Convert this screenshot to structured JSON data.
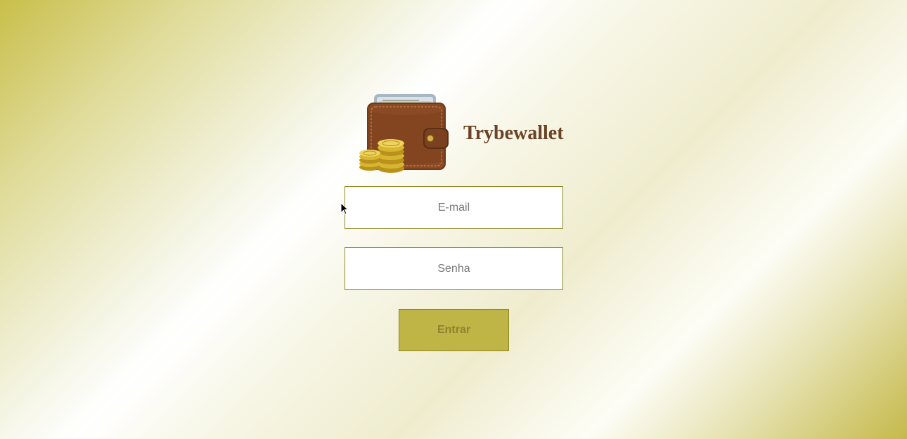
{
  "app": {
    "title": "Trybewallet",
    "logo_icon": "wallet-with-coins-icon"
  },
  "form": {
    "email_placeholder": "E-mail",
    "email_value": "",
    "password_placeholder": "Senha",
    "password_value": "",
    "submit_label": "Entrar",
    "submit_disabled": true
  },
  "colors": {
    "title": "#6b4226",
    "button_bg": "#bfb446",
    "button_text": "#8e832f",
    "field_border": "#8d8a25",
    "gradient_gold": "#c9bf4a"
  }
}
